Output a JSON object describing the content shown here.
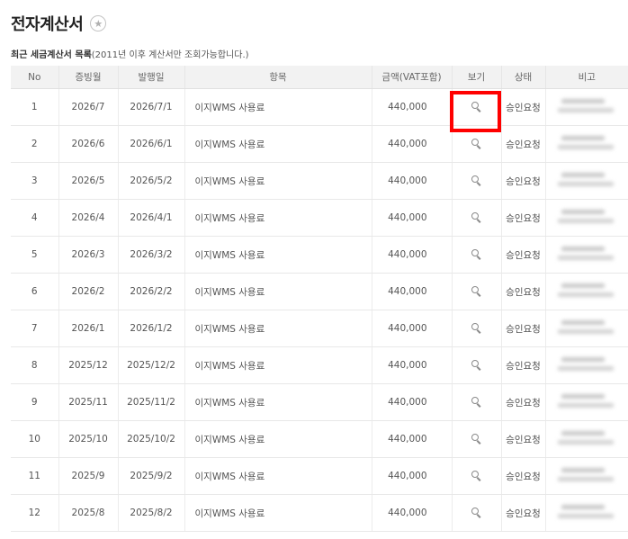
{
  "page": {
    "title": "전자계산서",
    "subtitle_bold": "최근 세금계산서 목록",
    "subtitle_note": "(2011년 이후 계산서만 조회가능합니다.)"
  },
  "table": {
    "headers": [
      "No",
      "증빙월",
      "발행일",
      "항목",
      "금액(VAT포함)",
      "보기",
      "상태",
      "비고"
    ],
    "rows": [
      {
        "no": "1",
        "month": "2026/7",
        "issued": "2026/7/1",
        "item": "이지WMS 사용료",
        "amount": "440,000",
        "status": "승인요청"
      },
      {
        "no": "2",
        "month": "2026/6",
        "issued": "2026/6/1",
        "item": "이지WMS 사용료",
        "amount": "440,000",
        "status": "승인요청"
      },
      {
        "no": "3",
        "month": "2026/5",
        "issued": "2026/5/2",
        "item": "이지WMS 사용료",
        "amount": "440,000",
        "status": "승인요청"
      },
      {
        "no": "4",
        "month": "2026/4",
        "issued": "2026/4/1",
        "item": "이지WMS 사용료",
        "amount": "440,000",
        "status": "승인요청"
      },
      {
        "no": "5",
        "month": "2026/3",
        "issued": "2026/3/2",
        "item": "이지WMS 사용료",
        "amount": "440,000",
        "status": "승인요청"
      },
      {
        "no": "6",
        "month": "2026/2",
        "issued": "2026/2/2",
        "item": "이지WMS 사용료",
        "amount": "440,000",
        "status": "승인요청"
      },
      {
        "no": "7",
        "month": "2026/1",
        "issued": "2026/1/2",
        "item": "이지WMS 사용료",
        "amount": "440,000",
        "status": "승인요청"
      },
      {
        "no": "8",
        "month": "2025/12",
        "issued": "2025/12/2",
        "item": "이지WMS 사용료",
        "amount": "440,000",
        "status": "승인요청"
      },
      {
        "no": "9",
        "month": "2025/11",
        "issued": "2025/11/2",
        "item": "이지WMS 사용료",
        "amount": "440,000",
        "status": "승인요청"
      },
      {
        "no": "10",
        "month": "2025/10",
        "issued": "2025/10/2",
        "item": "이지WMS 사용료",
        "amount": "440,000",
        "status": "승인요청"
      },
      {
        "no": "11",
        "month": "2025/9",
        "issued": "2025/9/2",
        "item": "이지WMS 사용료",
        "amount": "440,000",
        "status": "승인요청"
      },
      {
        "no": "12",
        "month": "2025/8",
        "issued": "2025/8/2",
        "item": "이지WMS 사용료",
        "amount": "440,000",
        "status": "승인요청"
      }
    ]
  },
  "icons": {
    "favorite": "star-icon",
    "view": "magnifier-icon"
  },
  "colors": {
    "highlight": "#ff0000",
    "header_bg": "#f2f2f2"
  }
}
